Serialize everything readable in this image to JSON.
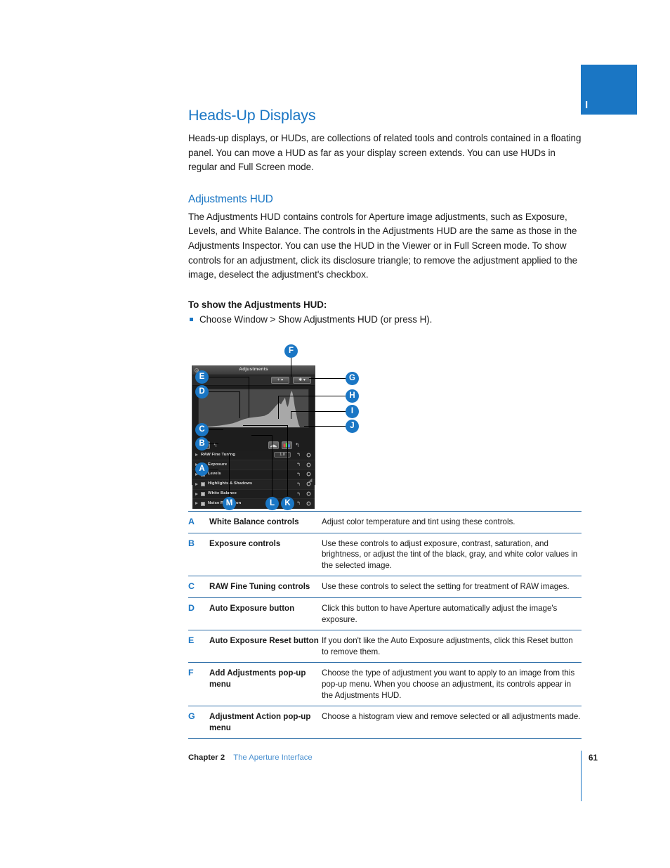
{
  "chapter_tab": {
    "letter": "I"
  },
  "heading": {
    "title": "Heads-Up Displays",
    "intro": "Heads-up displays, or HUDs, are collections of related tools and controls contained in a floating panel. You can move a HUD as far as your display screen extends. You can use HUDs in regular and Full Screen mode."
  },
  "section": {
    "title": "Adjustments HUD",
    "body": "The Adjustments HUD contains controls for Aperture image adjustments, such as Exposure, Levels, and White Balance. The controls in the Adjustments HUD are the same as those in the Adjustments Inspector. You can use the HUD in the Viewer or in Full Screen mode. To show controls for an adjustment, click its disclosure triangle; to remove the adjustment applied to the image, deselect the adjustment's checkbox.",
    "howto_head": "To show the Adjustments HUD:",
    "howto_step": "Choose Window > Show Adjustments HUD (or press H)."
  },
  "figure": {
    "hud": {
      "window_title": "Adjustments",
      "close_icon": "close-icon",
      "add_adjustments_menu": "add-adjustments-popup",
      "adjustment_action_menu": "adjustment-action-popup",
      "auto_exposure_button": "auto-exposure-icon",
      "auto_exposure_reset": "reset-arrow-icon",
      "histogram_view_button": "histogram-view-icon",
      "color_histogram_button": "color-histogram-icon",
      "histogram_reset": "reset-arrow-icon",
      "rows": [
        {
          "label": "RAW Fine Tuning",
          "value": "1.0",
          "has_checkbox": false
        },
        {
          "label": "Exposure",
          "value": "",
          "has_checkbox": true
        },
        {
          "label": "Levels",
          "value": "",
          "has_checkbox": true
        },
        {
          "label": "Highlights & Shadows",
          "value": "",
          "has_checkbox": true
        },
        {
          "label": "White Balance",
          "value": "",
          "has_checkbox": true
        },
        {
          "label": "Noise Reduction",
          "value": "",
          "has_checkbox": true
        }
      ]
    },
    "callouts": [
      {
        "key": "A"
      },
      {
        "key": "B"
      },
      {
        "key": "C"
      },
      {
        "key": "D"
      },
      {
        "key": "E"
      },
      {
        "key": "F"
      },
      {
        "key": "G"
      },
      {
        "key": "H"
      },
      {
        "key": "I"
      },
      {
        "key": "J"
      },
      {
        "key": "K"
      },
      {
        "key": "L"
      },
      {
        "key": "M"
      }
    ]
  },
  "reference_table": {
    "rows": [
      {
        "key": "A",
        "term": "White Balance controls",
        "desc": "Adjust color temperature and tint using these controls."
      },
      {
        "key": "B",
        "term": "Exposure controls",
        "desc": "Use these controls to adjust exposure, contrast, saturation, and brightness, or adjust the tint of the black, gray, and white color values in the selected image."
      },
      {
        "key": "C",
        "term": "RAW Fine Tuning controls",
        "desc": "Use these controls to select the setting for treatment of RAW images."
      },
      {
        "key": "D",
        "term": "Auto Exposure button",
        "desc": "Click this button to have Aperture automatically adjust the image's exposure."
      },
      {
        "key": "E",
        "term": "Auto Exposure Reset button",
        "desc": "If you don't like the Auto Exposure adjustments, click this Reset button to remove them."
      },
      {
        "key": "F",
        "term": "Add Adjustments pop-up menu",
        "desc": "Choose the type of adjustment you want to apply to an image from this pop-up menu. When you choose an adjustment, its controls appear in the Adjustments HUD."
      },
      {
        "key": "G",
        "term": "Adjustment Action pop-up menu",
        "desc": "Choose a histogram view and remove selected or all adjustments made."
      }
    ]
  },
  "footer": {
    "chapter": "Chapter 2",
    "section": "The Aperture Interface",
    "page": "61"
  },
  "colors": {
    "accent_blue": "#1a76c4",
    "link_blue": "#4a90d0"
  }
}
